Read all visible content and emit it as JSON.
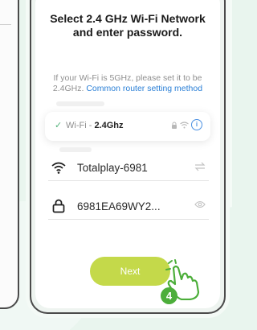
{
  "screen": {
    "title": "Select 2.4 GHz Wi-Fi Network and enter password.",
    "hint_text": "If your Wi-Fi is 5GHz, please set it to be 2.4GHz.",
    "hint_link": "Common router setting method"
  },
  "wifi_card": {
    "check_icon": "checkmark-icon",
    "prefix": "Wi-Fi - ",
    "band": "2.4Ghz",
    "icons": [
      "lock-icon",
      "wifi-icon",
      "info-icon"
    ],
    "info_glyph": "i"
  },
  "network_field": {
    "icon": "wifi-icon",
    "value": "Totalplay-6981",
    "action_icon": "switch-network-icon"
  },
  "password_field": {
    "icon": "lock-icon",
    "value": "6981EA69WY2...",
    "action_icon": "eye-icon"
  },
  "next_button": {
    "label": "Next"
  },
  "step_badge": {
    "number": "4"
  },
  "colors": {
    "accent": "#c4d94a",
    "link": "#2a7fd6",
    "badge": "#4cae3a",
    "check": "#52b37a"
  }
}
